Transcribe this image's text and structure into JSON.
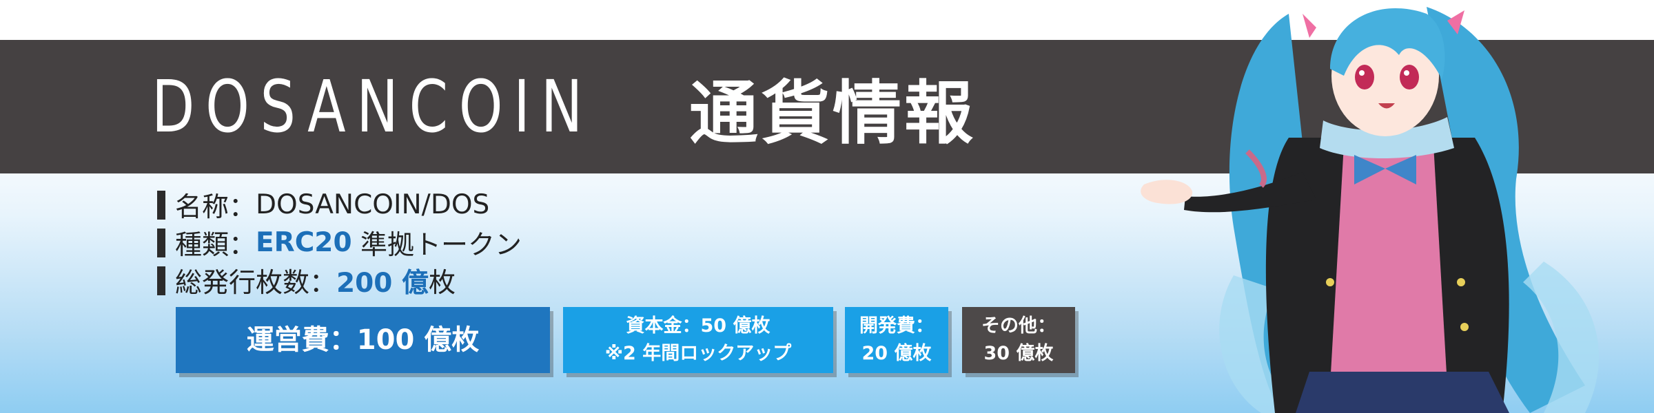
{
  "title": {
    "en": "DOSANCOIN",
    "jp": "通貨情報"
  },
  "info": [
    {
      "label": "名称：",
      "value": "DOSANCOIN/DOS",
      "highlight": "",
      "suffix": ""
    },
    {
      "label": "種類：",
      "value": "",
      "highlight": "ERC20",
      "suffix": " 準拠トークン"
    },
    {
      "label": "総発行枚数：",
      "value": "",
      "highlight": "200 億",
      "suffix": "枚"
    }
  ],
  "boxes": {
    "operations": {
      "line1": "運営費：100 億枚"
    },
    "capital": {
      "line1": "資本金：50 億枚",
      "line2": "※2 年間ロックアップ"
    },
    "development": {
      "line1": "開発費：",
      "line2": "20 億枚"
    },
    "other": {
      "line1": "その他：",
      "line2": "30 億枚"
    }
  },
  "colors": {
    "title_band": "#454142",
    "highlight": "#1c6fb8",
    "box_operations": "#1f76bf",
    "box_light": "#1aa0e6",
    "box_dark": "#4d4949"
  },
  "character": "anime-girl-mascot-illustration"
}
